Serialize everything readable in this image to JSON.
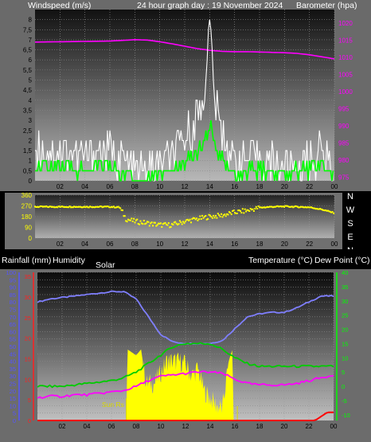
{
  "chart_data": [
    {
      "type": "line",
      "title": "24 hour graph day : 19 November 2024",
      "ylabel_left": "Windspeed (m/s)",
      "ylabel_right": "Barometer (hpa)",
      "x_tick_labels": [
        "02",
        "04",
        "06",
        "08",
        "10",
        "12",
        "14",
        "16",
        "18",
        "20",
        "22",
        "00"
      ],
      "ylim_left": [
        0,
        8.5
      ],
      "y_ticks_left": [
        "0",
        "0,5",
        "1",
        "1,5",
        "2",
        "2,5",
        "3",
        "3,5",
        "4",
        "4,5",
        "5",
        "5,5",
        "6",
        "6,5",
        "7",
        "7,5",
        "8"
      ],
      "ylim_right": [
        974,
        1024
      ],
      "y_ticks_right": [
        "975",
        "980",
        "985",
        "990",
        "995",
        "1000",
        "1005",
        "1010",
        "1015",
        "1020"
      ],
      "grid": true,
      "series": [
        {
          "color": "#ff00ff",
          "axis": "right",
          "x": [
            0,
            2,
            4,
            6,
            7,
            8,
            9,
            10,
            11,
            12,
            13,
            14,
            15,
            16,
            17,
            18,
            19,
            20,
            21,
            22,
            23,
            24
          ],
          "values": [
            1014.5,
            1014.6,
            1014.7,
            1014.8,
            1015,
            1015.2,
            1015.1,
            1014.6,
            1014,
            1013.3,
            1012.6,
            1012.1,
            1011.8,
            1011.7,
            1011.7,
            1011.6,
            1011.5,
            1011.4,
            1011.2,
            1010.8,
            1010.2,
            1009.6
          ]
        },
        {
          "color": "#ffffff",
          "axis": "left",
          "x": [
            0,
            1,
            2,
            3,
            4,
            5,
            6,
            7,
            8,
            9,
            10,
            11,
            12,
            13,
            13.5,
            14,
            14.2,
            14.5,
            15,
            16,
            17,
            18,
            19,
            20,
            21,
            22,
            23,
            24
          ],
          "values": [
            1.8,
            1.4,
            1.6,
            1.3,
            1.2,
            1.5,
            1.4,
            1.0,
            0.4,
            0.5,
            0.8,
            1.1,
            2.0,
            3.2,
            4.0,
            7.8,
            6.0,
            3.5,
            2.4,
            1.0,
            1.0,
            1.1,
            0.9,
            0.8,
            0.7,
            1.0,
            1.4,
            0.6
          ]
        },
        {
          "color": "#00ff00",
          "axis": "left",
          "x": [
            0,
            1,
            2,
            3,
            4,
            5,
            6,
            7,
            8,
            9,
            10,
            11,
            12,
            13,
            13.5,
            14,
            14.5,
            15,
            16,
            17,
            18,
            19,
            20,
            21,
            22,
            23,
            24
          ],
          "values": [
            0.7,
            0.6,
            0.7,
            0.6,
            0.5,
            0.7,
            0.7,
            0.4,
            0.1,
            0.2,
            0.4,
            0.6,
            0.9,
            1.4,
            1.8,
            2.8,
            1.6,
            1.2,
            0.4,
            0.5,
            0.5,
            0.4,
            0.5,
            0.5,
            0.6,
            0.7,
            0.2
          ]
        }
      ]
    },
    {
      "type": "scatter",
      "ylim": [
        0,
        360
      ],
      "y_ticks": [
        "0",
        "90",
        "180",
        "270",
        "360"
      ],
      "direction_labels": [
        "N",
        "W",
        "S",
        "E",
        "N"
      ],
      "x_tick_labels": [
        "02",
        "04",
        "06",
        "08",
        "10",
        "12",
        "14",
        "16",
        "18",
        "20",
        "22",
        "00"
      ],
      "series": [
        {
          "color": "#ffff00",
          "x": [
            0,
            1,
            2,
            3,
            4,
            5,
            6,
            6.8,
            7.3,
            8,
            9,
            10,
            11,
            12,
            13,
            14,
            15,
            16,
            17,
            18,
            19,
            20,
            21,
            22,
            23,
            24
          ],
          "values": [
            262,
            262,
            262,
            263,
            262,
            262,
            262,
            258,
            160,
            140,
            125,
            110,
            110,
            140,
            160,
            180,
            190,
            215,
            230,
            255,
            262,
            265,
            262,
            258,
            240,
            210
          ]
        }
      ]
    },
    {
      "type": "area",
      "labels": [
        "Rainfall (mm)",
        "Humidity",
        "Solar",
        "Temperature (°C)",
        "Dew Point (°C)"
      ],
      "annotation": "Sun Rs",
      "y_ticks_humidity": [
        "0",
        "5",
        "10",
        "15",
        "20",
        "25",
        "30",
        "35",
        "40",
        "45",
        "50",
        "55",
        "60",
        "65",
        "70",
        "75",
        "80",
        "85",
        "90",
        "95",
        "100"
      ],
      "y_ticks_rain": [
        "0",
        "5",
        "10",
        "15",
        "20",
        "25",
        "30",
        "35"
      ],
      "y_ticks_temp": [
        "-10",
        "-5",
        "0",
        "5",
        "10",
        "15",
        "20",
        "25",
        "30",
        "35",
        "40"
      ],
      "ylim_humidity": [
        0,
        100
      ],
      "ylim_temp": [
        -12,
        40
      ],
      "x_tick_labels": [
        "02",
        "04",
        "06",
        "08",
        "10",
        "12",
        "14",
        "16",
        "18",
        "20",
        "22",
        "00"
      ],
      "series": [
        {
          "name": "Humidity",
          "color": "#7f7fff",
          "axis": "humidity",
          "x": [
            0,
            1,
            2,
            3,
            4,
            5,
            6,
            7,
            8,
            9,
            10,
            11,
            12,
            13,
            14,
            15,
            16,
            17,
            18,
            19,
            20,
            21,
            22,
            23,
            24
          ],
          "values": [
            80,
            82,
            83,
            84,
            85,
            86,
            87,
            87,
            82,
            70,
            58,
            53,
            52,
            52,
            52,
            54,
            62,
            70,
            72,
            73,
            73,
            76,
            80,
            84,
            84
          ]
        },
        {
          "name": "Temperature",
          "color": "#00cc00",
          "axis": "temp",
          "x": [
            0,
            1,
            2,
            3,
            4,
            5,
            6,
            7,
            8,
            9,
            10,
            11,
            12,
            13,
            14,
            15,
            16,
            17,
            18,
            19,
            20,
            21,
            22,
            23,
            24
          ],
          "values": [
            0,
            0,
            0,
            0.5,
            1,
            1.5,
            2,
            3,
            5,
            8,
            11,
            14,
            15,
            15,
            15,
            13,
            10,
            8,
            7,
            7,
            7,
            7,
            7,
            7,
            7
          ]
        },
        {
          "name": "Dew Point",
          "color": "#ff00ff",
          "axis": "temp",
          "x": [
            0,
            1,
            2,
            3,
            4,
            5,
            6,
            7,
            8,
            9,
            10,
            11,
            12,
            13,
            14,
            15,
            16,
            17,
            18,
            19,
            20,
            21,
            22,
            23,
            24
          ],
          "values": [
            -4,
            -3.5,
            -3.5,
            -3,
            -3,
            -2.5,
            -2,
            -1.5,
            0,
            2,
            3.5,
            4,
            4.5,
            5,
            5,
            4.5,
            2.5,
            1,
            0.5,
            0.5,
            0.5,
            1,
            2,
            3,
            4
          ]
        },
        {
          "name": "Solar",
          "color": "#ffff00",
          "axis": "humidity",
          "x": [
            7.2,
            7.3,
            8,
            8.4,
            8.8,
            9.5,
            10.5,
            11.5,
            12,
            12.5,
            13,
            13.5,
            14,
            14.5,
            15,
            15.5,
            15.8,
            15.9
          ],
          "values": [
            0,
            48,
            44,
            48,
            25,
            25,
            40,
            40,
            38,
            30,
            35,
            20,
            15,
            10,
            8,
            40,
            48,
            0
          ]
        },
        {
          "name": "Rainfall",
          "color": "#ff0000",
          "axis": "rain",
          "x": [
            0,
            22.5,
            23,
            23.5,
            24
          ],
          "values": [
            0,
            0,
            1,
            2,
            2
          ]
        }
      ]
    }
  ]
}
